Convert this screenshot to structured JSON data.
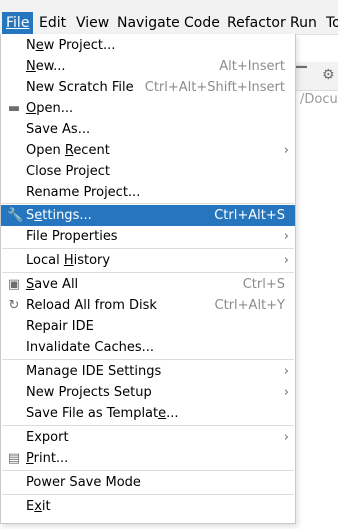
{
  "menubar": {
    "items": [
      "File",
      "Edit",
      "View",
      "Navigate",
      "Code",
      "Refactor",
      "Run",
      "To"
    ]
  },
  "background": {
    "path_text": "/Docu"
  },
  "file_menu": {
    "items": [
      {
        "label": "New Project...",
        "mnemonic": 1,
        "shortcut": "",
        "submenu": false
      },
      {
        "label": "New...",
        "mnemonic": 0,
        "shortcut": "Alt+Insert",
        "submenu": false
      },
      {
        "label": "New Scratch File",
        "mnemonic": -1,
        "shortcut": "Ctrl+Alt+Shift+Insert",
        "submenu": false
      },
      {
        "label": "Open...",
        "mnemonic": 0,
        "shortcut": "",
        "submenu": false,
        "icon": "folder-icon"
      },
      {
        "label": "Save As...",
        "mnemonic": -1,
        "shortcut": "",
        "submenu": false
      },
      {
        "label": "Open Recent",
        "mnemonic": 5,
        "shortcut": "",
        "submenu": true
      },
      {
        "label": "Close Project",
        "mnemonic": -1,
        "shortcut": "",
        "submenu": false
      },
      {
        "label": "Rename Project...",
        "mnemonic": -1,
        "shortcut": "",
        "submenu": false
      },
      {
        "label": "Settings...",
        "mnemonic": 1,
        "shortcut": "Ctrl+Alt+S",
        "submenu": false,
        "icon": "wrench-icon",
        "selected": true
      },
      {
        "label": "File Properties",
        "mnemonic": -1,
        "shortcut": "",
        "submenu": true
      },
      {
        "label": "Local History",
        "mnemonic": 6,
        "shortcut": "",
        "submenu": true
      },
      {
        "label": "Save All",
        "mnemonic": 0,
        "shortcut": "Ctrl+S",
        "submenu": false,
        "icon": "save-icon"
      },
      {
        "label": "Reload All from Disk",
        "mnemonic": -1,
        "shortcut": "Ctrl+Alt+Y",
        "submenu": false,
        "icon": "reload-icon"
      },
      {
        "label": "Repair IDE",
        "mnemonic": -1,
        "shortcut": "",
        "submenu": false
      },
      {
        "label": "Invalidate Caches...",
        "mnemonic": -1,
        "shortcut": "",
        "submenu": false
      },
      {
        "label": "Manage IDE Settings",
        "mnemonic": -1,
        "shortcut": "",
        "submenu": true
      },
      {
        "label": "New Projects Setup",
        "mnemonic": -1,
        "shortcut": "",
        "submenu": true
      },
      {
        "label": "Save File as Template...",
        "mnemonic": 20,
        "shortcut": "",
        "submenu": false
      },
      {
        "label": "Export",
        "mnemonic": -1,
        "shortcut": "",
        "submenu": true
      },
      {
        "label": "Print...",
        "mnemonic": 0,
        "shortcut": "",
        "submenu": false,
        "icon": "print-icon"
      },
      {
        "label": "Power Save Mode",
        "mnemonic": -1,
        "shortcut": "",
        "submenu": false
      },
      {
        "label": "Exit",
        "mnemonic": 1,
        "shortcut": "",
        "submenu": false
      }
    ]
  },
  "colors": {
    "selection": "#2675bf",
    "shortcut_text": "#8c8c8c",
    "separator": "#dcdcdc"
  }
}
